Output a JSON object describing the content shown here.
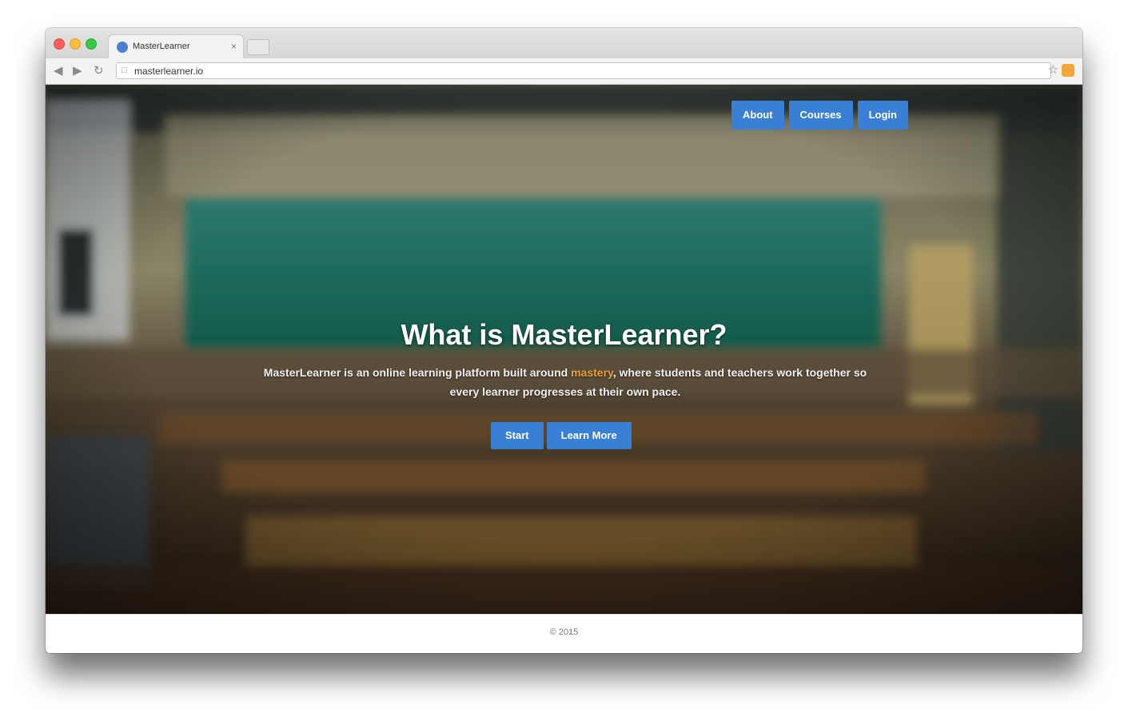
{
  "browser": {
    "tab_title": "MasterLearner",
    "tab_close_icon": "close-icon",
    "url": "masterlearner.io"
  },
  "site": {
    "nav": [
      {
        "label": "About"
      },
      {
        "label": "Courses"
      },
      {
        "label": "Login"
      }
    ],
    "hero": {
      "title": "What is MasterLearner?",
      "text_before": "MasterLearner is an online learning platform built around ",
      "text_accent": "mastery",
      "text_after": ", where students and teachers work together so every learner progresses at their own pace.",
      "buttons": [
        {
          "label": "Start"
        },
        {
          "label": "Learn More"
        }
      ]
    },
    "footer": {
      "text": "© 2015"
    }
  },
  "colors": {
    "accent": "#3a7fd6",
    "highlight": "#e6a23c"
  }
}
